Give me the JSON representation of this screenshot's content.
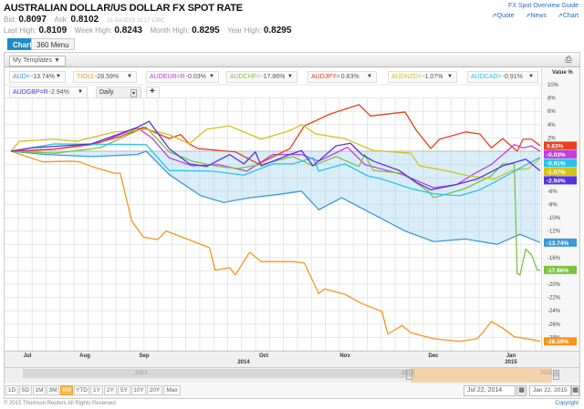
{
  "header": {
    "title": "AUSTRALIAN DOLLAR/US DOLLAR FX SPOT RATE",
    "bid_label": "Bid:",
    "bid": "0.8097",
    "ask_label": "Ask:",
    "ask": "0.8102",
    "timestamp": "22-Jul-2015 11:17 CIBC",
    "last_high_label": "Last High:",
    "last_high": "0.8109",
    "week_high_label": "Week High:",
    "week_high": "0.8243",
    "month_high_label": "Month High:",
    "month_high": "0.8295",
    "year_high_label": "Year High:",
    "year_high": "0.8295"
  },
  "links": {
    "guide": "FX Spot Overview Guide",
    "quote": "Quote",
    "news": "News",
    "chart": "Chart"
  },
  "tabs": [
    {
      "label": "Chart",
      "active": true
    },
    {
      "label": "360 Menu",
      "active": false
    }
  ],
  "toolbar": {
    "templates": "My Templates ▼",
    "print_icon": "printer-icon"
  },
  "interval": "Daily",
  "add_label": "+",
  "axis": {
    "header": "Value %",
    "ticks": [
      "10%",
      "8%",
      "6%",
      "4%",
      "2%",
      "0%",
      "-2%",
      "-4%",
      "-6%",
      "-8%",
      "-10%",
      "-12%",
      "-14%",
      "-16%",
      "-18%",
      "-20%",
      "-22%",
      "-24%",
      "-26%",
      "-28%"
    ]
  },
  "xaxis": {
    "months": [
      "Jul",
      "Aug",
      "Sep",
      "Oct",
      "Nov",
      "Dec",
      "Jan"
    ],
    "years": [
      "2014",
      "2015"
    ]
  },
  "navigator": {
    "years": [
      "2013",
      "2014",
      "2015"
    ]
  },
  "ranges": [
    "1D",
    "5D",
    "1M",
    "3M",
    "6M",
    "YTD",
    "1Y",
    "2Y",
    "5Y",
    "10Y",
    "20Y",
    "Max"
  ],
  "active_range": "6M",
  "dates": {
    "from": "Jul 22, 2014",
    "to": "Jan 22, 2015"
  },
  "footer": {
    "copyright": "© 2015 Thomson Reuters All Rights Reserved",
    "link": "Copyright"
  },
  "chart_data": {
    "type": "line",
    "ylabel": "Value %",
    "ylim": [
      -30,
      11
    ],
    "x_unit": "days since Jul 22, 2014",
    "xlim": [
      0,
      184
    ],
    "series": [
      {
        "name": "AUD=",
        "change": "-13.74%",
        "color": "#3a9ad9",
        "fill": true,
        "points": [
          [
            0,
            0
          ],
          [
            12,
            -0.5
          ],
          [
            28,
            -0.8
          ],
          [
            44,
            -0.5
          ],
          [
            47,
            0
          ],
          [
            55,
            -3.5
          ],
          [
            66,
            -6.7
          ],
          [
            74,
            -7.7
          ],
          [
            83,
            -7
          ],
          [
            93,
            -6.5
          ],
          [
            101,
            -6
          ],
          [
            107,
            -8.8
          ],
          [
            115,
            -7
          ],
          [
            126,
            -9.5
          ],
          [
            137,
            -12
          ],
          [
            147,
            -13.6
          ],
          [
            158,
            -13.2
          ],
          [
            169,
            -14
          ],
          [
            177,
            -12.5
          ],
          [
            184,
            -13.74
          ]
        ]
      },
      {
        "name": "TIOc1",
        "change": "-28.59%",
        "color": "#f7941d",
        "points": [
          [
            0,
            0
          ],
          [
            11,
            -1.6
          ],
          [
            21,
            -1.5
          ],
          [
            24,
            -1.6
          ],
          [
            28,
            -2.3
          ],
          [
            36,
            -3.3
          ],
          [
            38,
            -3.3
          ],
          [
            42,
            -10.5
          ],
          [
            46,
            -12.9
          ],
          [
            51,
            -13.3
          ],
          [
            54,
            -12
          ],
          [
            69,
            -14.5
          ],
          [
            71,
            -17.9
          ],
          [
            76,
            -17.5
          ],
          [
            78,
            -18.6
          ],
          [
            83,
            -15.2
          ],
          [
            87,
            -16.6
          ],
          [
            98,
            -16.6
          ],
          [
            102,
            -16.8
          ],
          [
            107,
            -21.4
          ],
          [
            109,
            -20.7
          ],
          [
            116,
            -21.5
          ],
          [
            122,
            -22.9
          ],
          [
            129,
            -24.1
          ],
          [
            131,
            -27.5
          ],
          [
            136,
            -26.2
          ],
          [
            139,
            -27.3
          ],
          [
            147,
            -28.2
          ],
          [
            156,
            -28.6
          ],
          [
            162,
            -28.2
          ],
          [
            164,
            -27.3
          ],
          [
            167,
            -25.6
          ],
          [
            171,
            -26.6
          ],
          [
            175,
            -27.9
          ],
          [
            182,
            -28.4
          ],
          [
            184,
            -28.59
          ]
        ]
      },
      {
        "name": "AUDEUR=R",
        "change": "-0.03%",
        "color": "#c040e0",
        "points": [
          [
            0,
            0
          ],
          [
            15,
            0.3
          ],
          [
            31,
            1.3
          ],
          [
            44,
            3.5
          ],
          [
            49,
            2
          ],
          [
            55,
            -1
          ],
          [
            63,
            -2.2
          ],
          [
            72,
            -2
          ],
          [
            82,
            -3
          ],
          [
            91,
            -0.5
          ],
          [
            101,
            -0.5
          ],
          [
            107,
            -1.5
          ],
          [
            117,
            0.6
          ],
          [
            123,
            -2
          ],
          [
            136,
            -3.5
          ],
          [
            147,
            -5.5
          ],
          [
            155,
            -5
          ],
          [
            161,
            -3.4
          ],
          [
            167,
            -2
          ],
          [
            175,
            1
          ],
          [
            178,
            0.5
          ],
          [
            181,
            0.8
          ],
          [
            184,
            -0.03
          ]
        ]
      },
      {
        "name": "AUDCHF=",
        "change": "-17.86%",
        "color": "#7dc242",
        "points": [
          [
            0,
            0
          ],
          [
            15,
            -0.3
          ],
          [
            31,
            0.5
          ],
          [
            44,
            3.1
          ],
          [
            47,
            3.6
          ],
          [
            55,
            -0.1
          ],
          [
            63,
            -1.5
          ],
          [
            72,
            -2.3
          ],
          [
            79,
            -2.6
          ],
          [
            88,
            -1.9
          ],
          [
            98,
            -0.8
          ],
          [
            105,
            -2.2
          ],
          [
            113,
            -0.8
          ],
          [
            121,
            -2.3
          ],
          [
            123,
            -0.5
          ],
          [
            126,
            -2.9
          ],
          [
            136,
            -3.3
          ],
          [
            145,
            -6
          ],
          [
            147,
            -7
          ],
          [
            158,
            -5.6
          ],
          [
            167,
            -3.7
          ],
          [
            171,
            -1.9
          ],
          [
            175,
            -1.9
          ],
          [
            176,
            -18.4
          ],
          [
            177,
            -18.6
          ],
          [
            179,
            -14.7
          ],
          [
            181,
            -15.6
          ],
          [
            183,
            -17.9
          ],
          [
            184,
            -17.86
          ]
        ]
      },
      {
        "name": "AUDJPY=",
        "change": "0.83%",
        "color": "#e8401c",
        "points": [
          [
            0,
            0
          ],
          [
            15,
            0.3
          ],
          [
            28,
            1
          ],
          [
            38,
            2.2
          ],
          [
            46,
            3.6
          ],
          [
            55,
            1.9
          ],
          [
            59,
            2.5
          ],
          [
            62,
            1.1
          ],
          [
            65,
            0.4
          ],
          [
            78,
            -0.1
          ],
          [
            86,
            -1.9
          ],
          [
            97,
            0.4
          ],
          [
            102,
            3.8
          ],
          [
            111,
            5.6
          ],
          [
            121,
            7
          ],
          [
            125,
            5.3
          ],
          [
            137,
            5.9
          ],
          [
            141,
            3.1
          ],
          [
            146,
            0.4
          ],
          [
            149,
            1.8
          ],
          [
            158,
            2.9
          ],
          [
            163,
            2.6
          ],
          [
            167,
            0.5
          ],
          [
            171,
            1.9
          ],
          [
            176,
            0
          ],
          [
            178,
            1.8
          ],
          [
            181,
            1.8
          ],
          [
            184,
            0.83
          ]
        ]
      },
      {
        "name": "AUDNZD=",
        "change": "-1.07%",
        "color": "#d4c21a",
        "points": [
          [
            0,
            0
          ],
          [
            3,
            1.5
          ],
          [
            15,
            1.8
          ],
          [
            23,
            1.5
          ],
          [
            36,
            2.9
          ],
          [
            43,
            3.1
          ],
          [
            47,
            3.3
          ],
          [
            55,
            2.5
          ],
          [
            62,
            1.1
          ],
          [
            68,
            3.3
          ],
          [
            76,
            3.8
          ],
          [
            87,
            1.8
          ],
          [
            97,
            3.1
          ],
          [
            101,
            4
          ],
          [
            106,
            2.6
          ],
          [
            116,
            1.9
          ],
          [
            126,
            0.1
          ],
          [
            139,
            -0.3
          ],
          [
            142,
            -2.2
          ],
          [
            152,
            -3
          ],
          [
            159,
            -3.7
          ],
          [
            168,
            -4.2
          ],
          [
            174,
            -2.9
          ],
          [
            180,
            -2.6
          ],
          [
            184,
            -1.07
          ]
        ]
      },
      {
        "name": "AUDCAD=",
        "change": "-0.91%",
        "color": "#29c3e8",
        "points": [
          [
            0,
            0
          ],
          [
            15,
            1.1
          ],
          [
            47,
            1
          ],
          [
            55,
            -2.9
          ],
          [
            70,
            -3
          ],
          [
            81,
            -3.6
          ],
          [
            91,
            -1.9
          ],
          [
            98,
            -1.9
          ],
          [
            105,
            -1
          ],
          [
            107,
            -3
          ],
          [
            116,
            -1.9
          ],
          [
            124,
            -3.7
          ],
          [
            129,
            -4.2
          ],
          [
            139,
            -5.6
          ],
          [
            147,
            -6.4
          ],
          [
            156,
            -6.7
          ],
          [
            163,
            -5.8
          ],
          [
            168,
            -4.7
          ],
          [
            175,
            -3
          ],
          [
            184,
            -0.91
          ]
        ]
      },
      {
        "name": "AUDGBP=R",
        "change": "-2.94%",
        "color": "#5533dd",
        "points": [
          [
            0,
            0
          ],
          [
            7,
            0.5
          ],
          [
            28,
            1.1
          ],
          [
            44,
            3.6
          ],
          [
            48,
            4.5
          ],
          [
            55,
            0.4
          ],
          [
            62,
            -1.9
          ],
          [
            68,
            -2.3
          ],
          [
            76,
            -0.5
          ],
          [
            81,
            -1.9
          ],
          [
            85,
            -0.1
          ],
          [
            87,
            -2.2
          ],
          [
            97,
            -0.5
          ],
          [
            101,
            0.1
          ],
          [
            105,
            -2.2
          ],
          [
            113,
            0.8
          ],
          [
            118,
            1.2
          ],
          [
            122,
            -0.5
          ],
          [
            126,
            -1.5
          ],
          [
            135,
            -2.9
          ],
          [
            141,
            -4.7
          ],
          [
            146,
            -5.8
          ],
          [
            154,
            -5.1
          ],
          [
            162,
            -4.2
          ],
          [
            171,
            -2.2
          ],
          [
            179,
            -1.2
          ],
          [
            184,
            -2.94
          ]
        ]
      }
    ]
  }
}
